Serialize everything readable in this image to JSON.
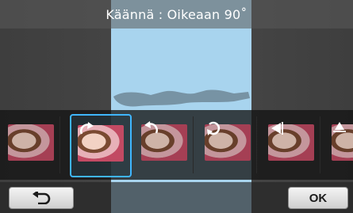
{
  "header": {
    "title": "Käännä : Oikeaan 90˚"
  },
  "colors": {
    "accent": "#3fb6ff",
    "preview_bg": "#a8d4ee",
    "photo_pink": "#c24a63"
  },
  "thumbnails": [
    {
      "name": "original",
      "icon": "none",
      "selected": false
    },
    {
      "name": "rotate-right-90",
      "icon": "rotate-right-icon",
      "selected": true
    },
    {
      "name": "rotate-left-90",
      "icon": "rotate-left-icon",
      "selected": false
    },
    {
      "name": "rotate-180",
      "icon": "rotate-180-icon",
      "selected": false
    },
    {
      "name": "flip-horizontal",
      "icon": "flip-horizontal-icon",
      "selected": false
    },
    {
      "name": "flip-vertical",
      "icon": "flip-vertical-icon",
      "selected": false
    }
  ],
  "buttons": {
    "back_icon": "back-arrow-icon",
    "ok_label": "OK"
  }
}
